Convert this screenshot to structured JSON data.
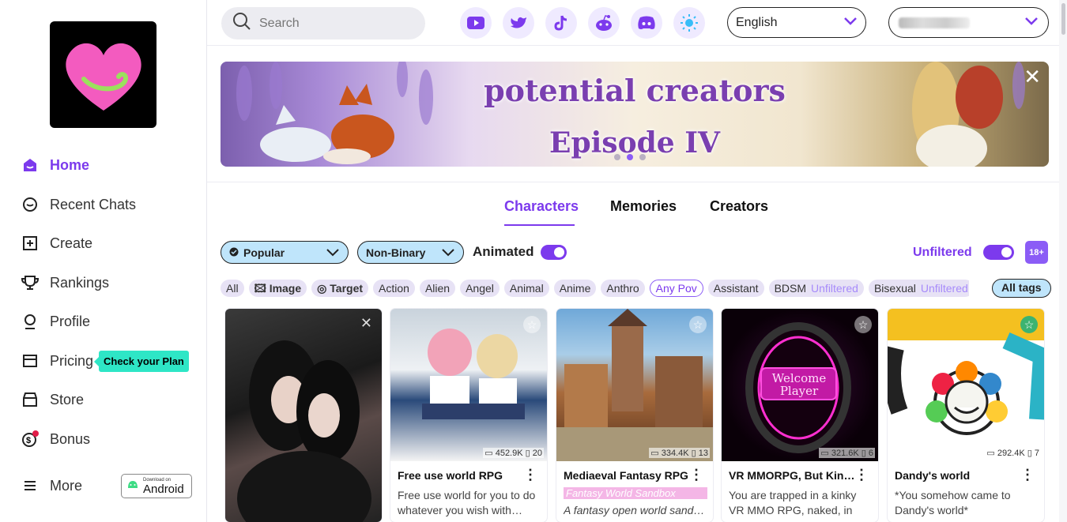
{
  "sidebar": {
    "items": [
      {
        "label": "Home",
        "icon": "home-icon"
      },
      {
        "label": "Recent Chats",
        "icon": "chat-icon"
      },
      {
        "label": "Create",
        "icon": "plus-square-icon"
      },
      {
        "label": "Rankings",
        "icon": "trophy-icon"
      },
      {
        "label": "Profile",
        "icon": "profile-icon"
      },
      {
        "label": "Pricing",
        "icon": "pricing-card-icon"
      },
      {
        "label": "Store",
        "icon": "store-icon"
      },
      {
        "label": "Bonus",
        "icon": "bonus-coin-icon"
      },
      {
        "label": "More",
        "icon": "menu-icon"
      }
    ],
    "plan_tip": "Check your Plan",
    "android_small": "Download on",
    "android_big": "Android"
  },
  "header": {
    "search_placeholder": "Search",
    "language": "English",
    "social_icons": [
      "youtube-icon",
      "twitter-icon",
      "tiktok-icon",
      "reddit-icon",
      "discord-icon",
      "theme-sun-icon"
    ]
  },
  "banner": {
    "line1": "potential creators",
    "line2": "Episode IV"
  },
  "tabs": [
    "Characters",
    "Memories",
    "Creators"
  ],
  "filters": {
    "sort": "Popular",
    "gender": "Non-Binary",
    "animated_label": "Animated",
    "unfiltered_label": "Unfiltered",
    "adult_badge": "18+"
  },
  "tags": [
    {
      "label": "All"
    },
    {
      "label": "Image",
      "icon": "image-icon"
    },
    {
      "label": "Target",
      "icon": "target-icon"
    },
    {
      "label": "Action"
    },
    {
      "label": "Alien"
    },
    {
      "label": "Angel"
    },
    {
      "label": "Animal"
    },
    {
      "label": "Anime"
    },
    {
      "label": "Anthro"
    },
    {
      "label": "Any Pov"
    },
    {
      "label": "Assistant"
    },
    {
      "label": "BDSM",
      "badge": "Unfiltered"
    },
    {
      "label": "Bisexual",
      "badge": "Unfiltered"
    }
  ],
  "all_tags": "All tags",
  "cards": [
    {
      "title": "",
      "desc": "",
      "stats_msgs": "",
      "stats_mem": ""
    },
    {
      "title": "Free use world RPG",
      "desc": "Free use world for you to do whatever you wish with…",
      "stats_msgs": "452.9K",
      "stats_mem": "20"
    },
    {
      "title": "Mediaeval Fantasy RPG",
      "sub": "Fantasy World Sandbox",
      "desc": "A fantasy open world sand…",
      "stats_msgs": "334.4K",
      "stats_mem": "13"
    },
    {
      "title": "VR MMORPG, But Kinky,…",
      "desc": "You are trapped in a kinky VR MMO RPG, naked, in a…",
      "stats_msgs": "321.6K",
      "stats_mem": "6",
      "image_text": "Welcome Player"
    },
    {
      "title": "Dandy's world",
      "desc": "*You somehow came to Dandy's world*",
      "stats_msgs": "292.4K",
      "stats_mem": "7"
    }
  ],
  "colors": {
    "accent": "#7c3aed",
    "chip": "#bfe5fb",
    "tip": "#2ee6c6"
  }
}
